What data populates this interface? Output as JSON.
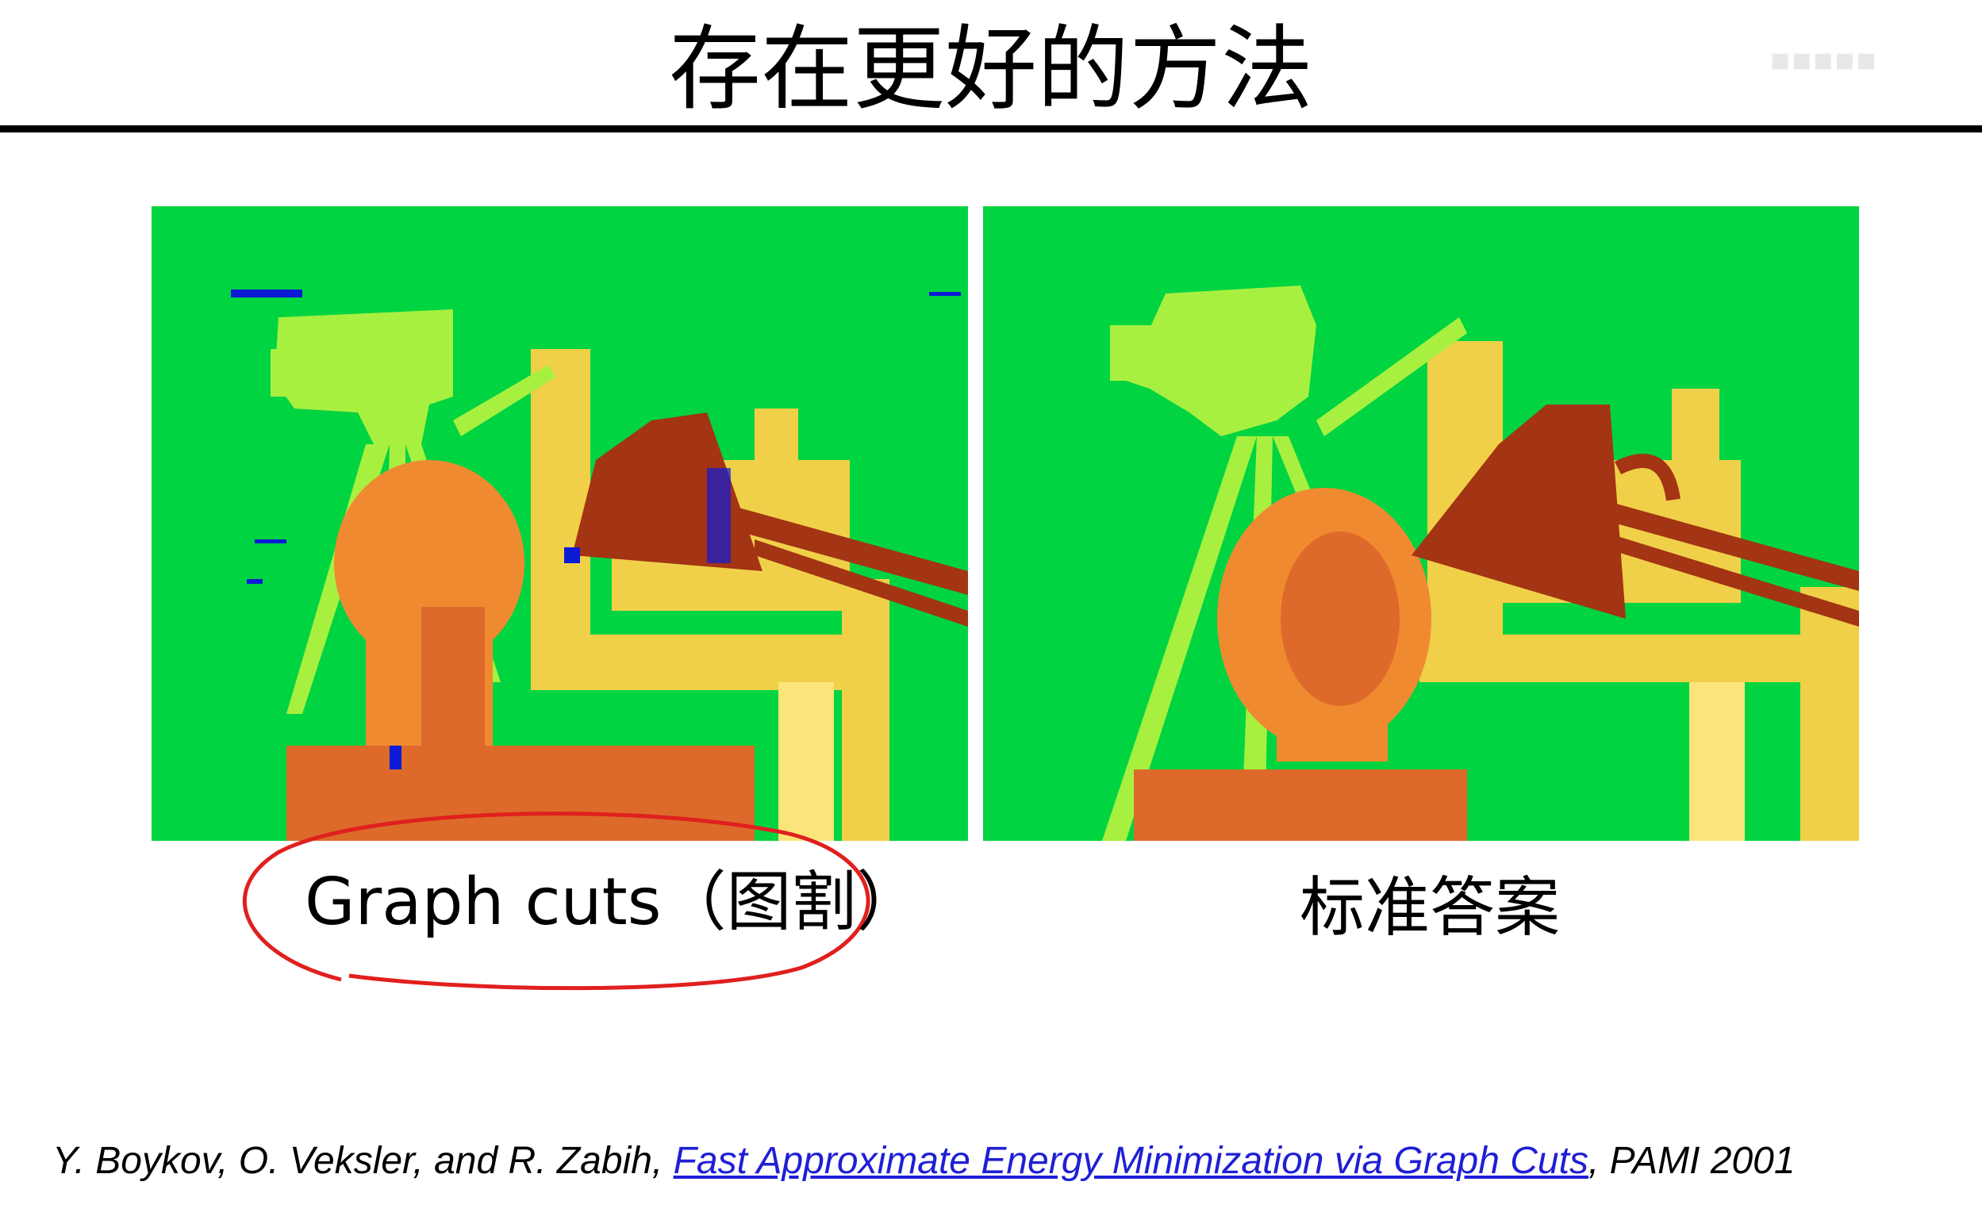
{
  "slide": {
    "title": "存在更好的方法"
  },
  "figures": {
    "left_caption": "Graph cuts（图割）",
    "right_caption": "标准答案"
  },
  "citation": {
    "authors": "Y. Boykov, O. Veksler, and R. Zabih,",
    "paper_title": "Fast Approximate Energy Minimization via Graph Cuts",
    "venue": ",  PAMI 2001"
  },
  "colors": {
    "background_green": "#00d441",
    "camera_lightgreen": "#a8f040",
    "box_yellow": "#f0d048",
    "box_paleyellow": "#fbe47a",
    "head_orange": "#f08a30",
    "head_darkorange": "#dd6a2a",
    "lamp_brown": "#a33414",
    "noise_blue": "#0b1bd6",
    "annotation_red": "#e0201e",
    "link_blue": "#1f1fd6"
  }
}
